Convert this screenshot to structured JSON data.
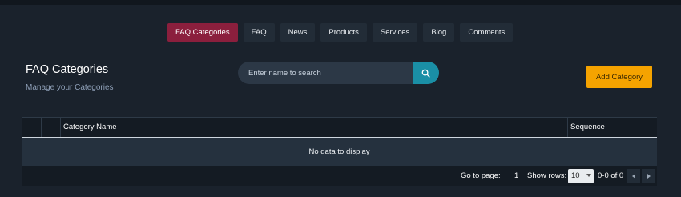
{
  "tabs": [
    {
      "label": "FAQ Categories",
      "active": true
    },
    {
      "label": "FAQ",
      "active": false
    },
    {
      "label": "News",
      "active": false
    },
    {
      "label": "Products",
      "active": false
    },
    {
      "label": "Services",
      "active": false
    },
    {
      "label": "Blog",
      "active": false
    },
    {
      "label": "Comments",
      "active": false
    }
  ],
  "header": {
    "title": "FAQ Categories",
    "subtitle": "Manage your Categories"
  },
  "search": {
    "placeholder": "Enter name to search",
    "value": "",
    "icon": "search-icon"
  },
  "add_button": {
    "label": "Add Category"
  },
  "table": {
    "columns": [
      "Category Name",
      "Sequence"
    ],
    "empty_message": "No data to display"
  },
  "pager": {
    "go_to_label": "Go to page:",
    "page": "1",
    "show_rows_label": "Show rows:",
    "rows_per_page": "10",
    "range": "0-0 of 0"
  },
  "colors": {
    "background": "#1a222c",
    "active_tab": "#8b1f3d",
    "search_button": "#1a8fa6",
    "add_button": "#f5a300"
  }
}
